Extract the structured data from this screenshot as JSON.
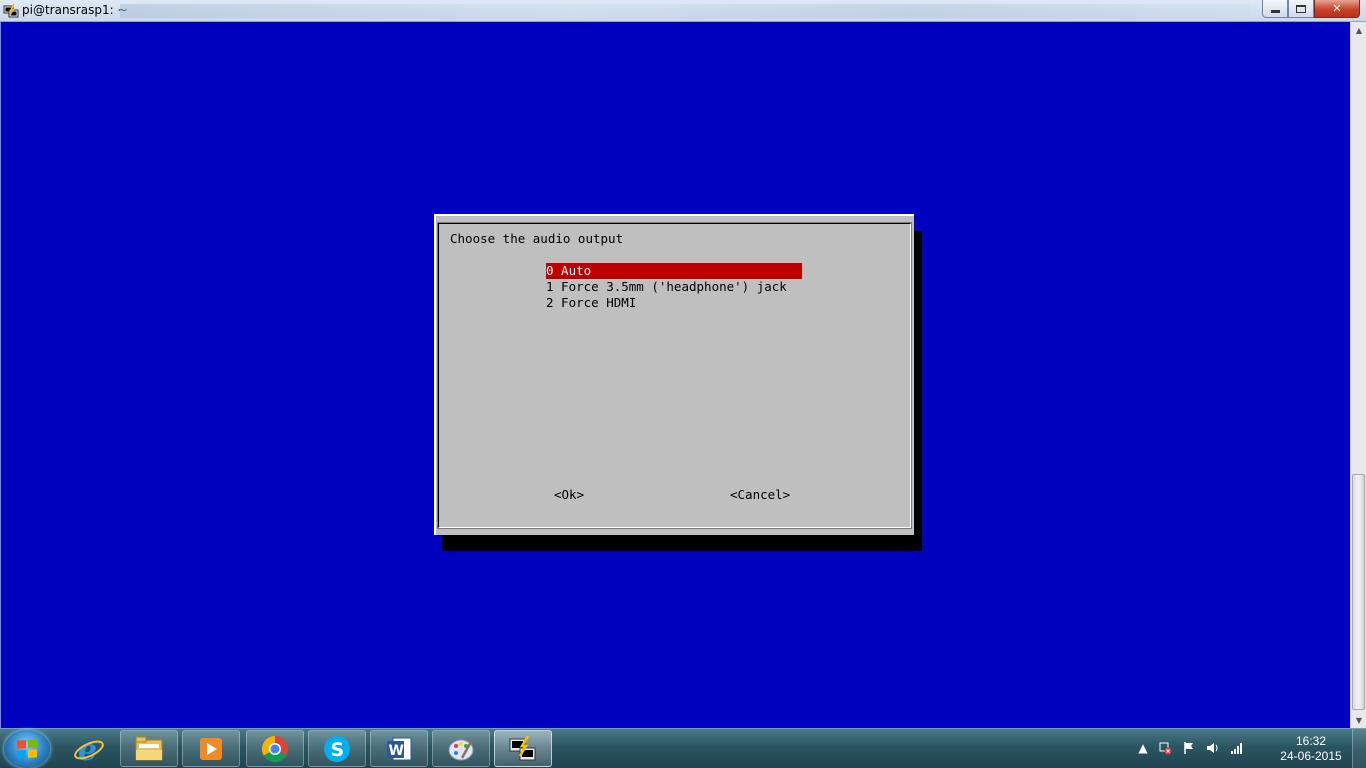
{
  "window": {
    "title": "pi@transrasp1: ~",
    "app_icon": "putty-icon",
    "buttons": [
      "minimize",
      "maximize",
      "close"
    ],
    "close_glyph": "✕"
  },
  "terminal": {
    "background": "#0000bf",
    "dialog": {
      "prompt": "Choose the audio output",
      "options": [
        {
          "label": "0 Auto",
          "selected": true
        },
        {
          "label": "1 Force 3.5mm ('headphone') jack",
          "selected": false
        },
        {
          "label": "2 Force HDMI",
          "selected": false
        }
      ],
      "ok_label": "<Ok>",
      "cancel_label": "<Cancel>",
      "selection_color": "#bf0000"
    }
  },
  "taskbar": {
    "pinned": [
      "internet-explorer-icon",
      "file-explorer-icon",
      "media-player-icon",
      "chrome-icon",
      "skype-icon",
      "word-icon",
      "paint-icon",
      "putty-icon"
    ],
    "active": "putty-icon",
    "tray_icons": [
      "show-hidden-icons-icon",
      "network-error-icon",
      "action-center-flag-icon",
      "volume-icon",
      "signal-icon"
    ],
    "clock": {
      "time": "16:32",
      "date": "24-06-2015"
    }
  }
}
